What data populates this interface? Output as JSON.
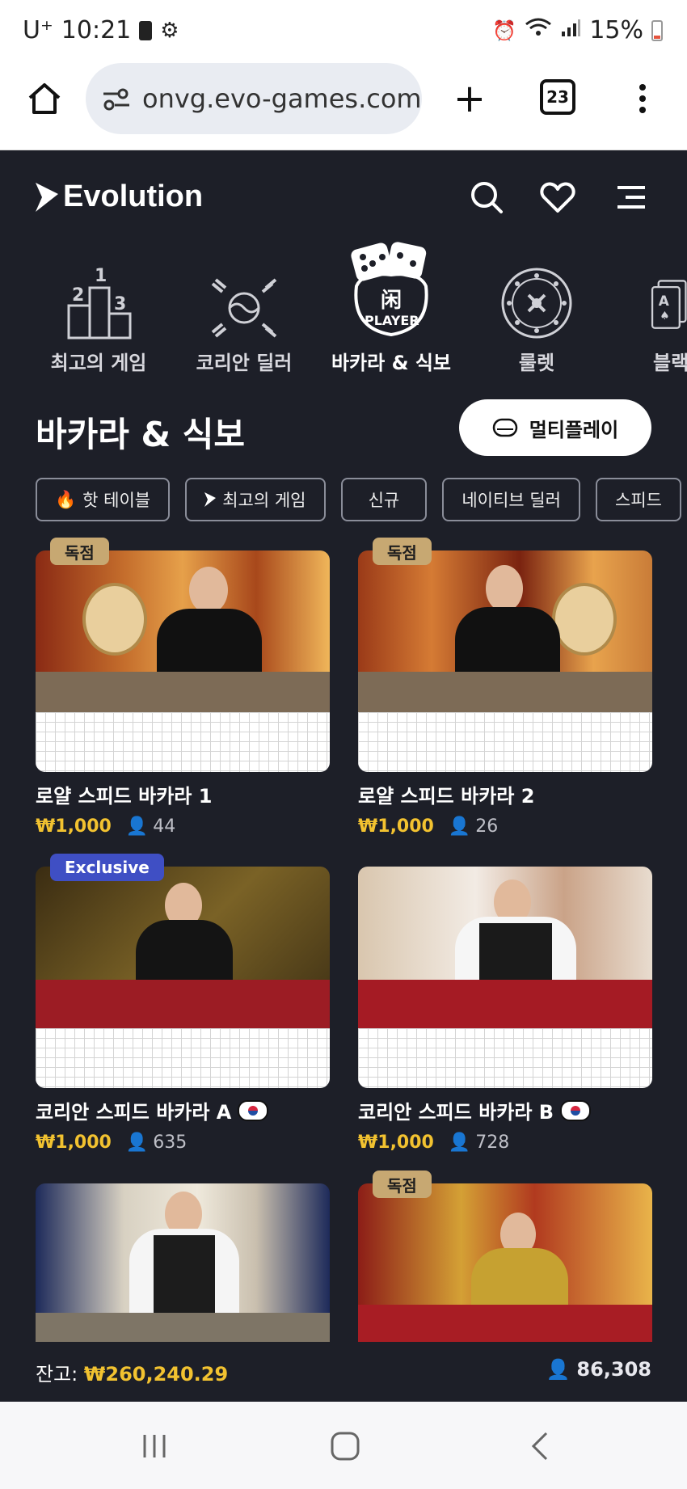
{
  "status": {
    "carrier": "U⁺",
    "time": "10:21",
    "battery": "15%"
  },
  "browser": {
    "url": "onvg.evo-games.com",
    "tab_count": "23"
  },
  "header": {
    "brand": "Evolution"
  },
  "categories": [
    {
      "label": "최고의 게임",
      "icon": "podium-icon"
    },
    {
      "label": "코리안 딜러",
      "icon": "korea-emblem-icon"
    },
    {
      "label": "바카라 & 식보",
      "icon": "dice-player-icon",
      "active": true
    },
    {
      "label": "룰렛",
      "icon": "roulette-icon"
    },
    {
      "label": "블랙",
      "icon": "card-icon"
    }
  ],
  "section": {
    "title": "바카라 & 식보",
    "multiplay_label": "멀티플레이"
  },
  "chips": [
    "핫 테이블",
    "최고의 게임",
    "신규",
    "네이티브 딜러",
    "스피드"
  ],
  "games": [
    {
      "title": "로얄 스피드 바카라 1",
      "price": "₩1,000",
      "players": "44",
      "badge": "독점"
    },
    {
      "title": "로얄 스피드 바카라 2",
      "price": "₩1,000",
      "players": "26",
      "badge": "독점"
    },
    {
      "title": "코리안 스피드 바카라 A",
      "price": "₩1,000",
      "players": "635",
      "badge": "Exclusive"
    },
    {
      "title": "코리안 스피드 바카라 B",
      "price": "₩1,000",
      "players": "728",
      "badge": ""
    },
    {
      "title": "",
      "price": "",
      "players": "",
      "badge": ""
    },
    {
      "title": "",
      "price": "",
      "players": "",
      "badge": "독점"
    }
  ],
  "footer": {
    "balance_label": "잔고:",
    "balance_amount": "₩260,240.29",
    "total_players": "86,308"
  },
  "colors": {
    "accent_gold": "#f2c230",
    "badge_gold": "#c7a872",
    "badge_blue": "#3f4fc4",
    "background": "#1d1f28"
  }
}
